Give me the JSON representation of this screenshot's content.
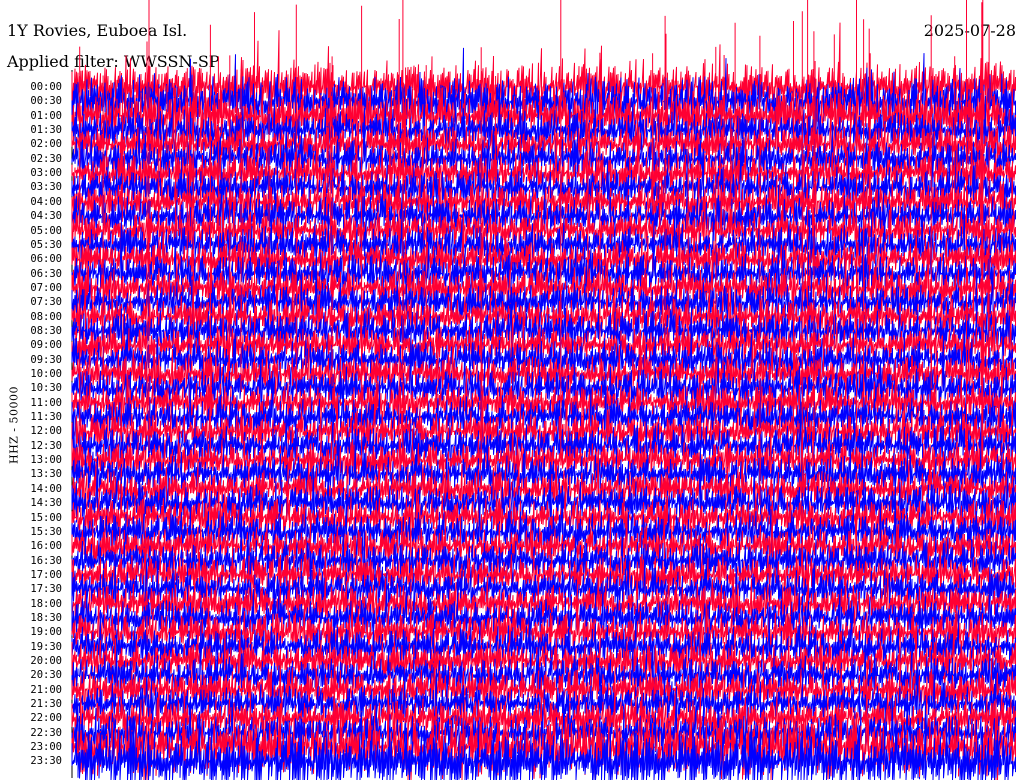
{
  "chart_data": {
    "type": "line",
    "station": "1Y Rovies, Euboea Isl.",
    "date": "2025-07-28",
    "filter_label": "Applied filter: WWSSN-SP",
    "channel_label": "HHZ - 50000",
    "row_times": [
      "00:00",
      "00:30",
      "01:00",
      "01:30",
      "02:00",
      "02:30",
      "03:00",
      "03:30",
      "04:00",
      "04:30",
      "05:00",
      "05:30",
      "06:00",
      "06:30",
      "07:00",
      "07:30",
      "08:00",
      "08:30",
      "09:00",
      "09:30",
      "10:00",
      "10:30",
      "11:00",
      "11:30",
      "12:00",
      "12:30",
      "13:00",
      "13:30",
      "14:00",
      "14:30",
      "15:00",
      "15:30",
      "16:00",
      "16:30",
      "17:00",
      "17:30",
      "18:00",
      "18:30",
      "19:00",
      "19:30",
      "20:00",
      "20:30",
      "21:00",
      "21:30",
      "22:00",
      "22:30",
      "23:00",
      "23:30"
    ],
    "colors": {
      "odd_trace": "#0000ff",
      "even_trace": "#ff0033"
    }
  }
}
